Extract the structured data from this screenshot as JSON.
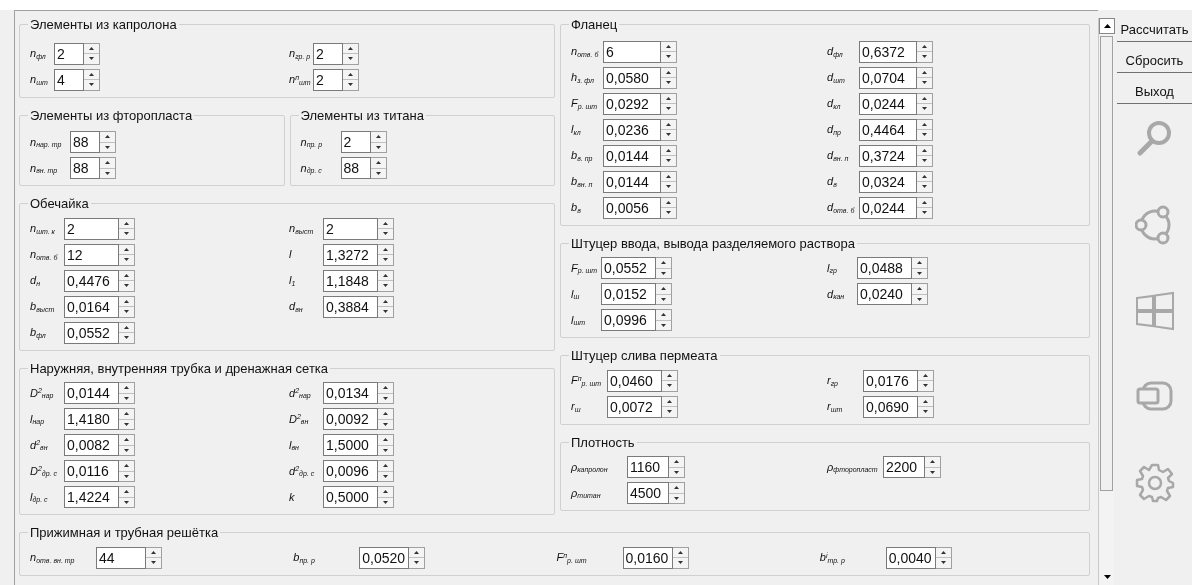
{
  "left": [
    {
      "title": "Элементы из капролона",
      "fields": [
        {
          "label": "n$_{фл}$",
          "value": "2"
        },
        {
          "label": "n$_{гр. р}$",
          "value": "2"
        },
        {
          "label": "n$_{шт}$",
          "value": "4"
        },
        {
          "label": "n$^{п}$$_{шт}$",
          "value": "2"
        }
      ]
    },
    {
      "side_by_side": [
        {
          "title": "Элементы из фторопласта",
          "fields": [
            {
              "label": "n$_{нар. тр}$",
              "value": "88"
            },
            {
              "label": "n$_{вн. тр}$",
              "value": "88"
            }
          ]
        },
        {
          "title": "Элементы из титана",
          "fields": [
            {
              "label": "n$_{пр. р}$",
              "value": "2"
            },
            {
              "label": "n$_{др. с}$",
              "value": "88"
            }
          ]
        }
      ]
    },
    {
      "title": "Обечайка",
      "fields": [
        {
          "label": "n$_{шт. к}$",
          "value": "2"
        },
        {
          "label": "n$_{выст}$",
          "value": "2"
        },
        {
          "label": "n$_{отв. б}$",
          "value": "12"
        },
        {
          "label": "l",
          "value": "1,3272"
        },
        {
          "label": "d$_{н}$",
          "value": "0,4476"
        },
        {
          "label": "l$_{1}$",
          "value": "1,1848"
        },
        {
          "label": "b$_{выст}$",
          "value": "0,0164"
        },
        {
          "label": "d$_{вн}$",
          "value": "0,3884"
        },
        {
          "label": "b$_{фл}$",
          "value": "0,0552"
        }
      ]
    },
    {
      "title": "Наружняя, внутренняя трубка и дренажная сетка",
      "fields": [
        {
          "label": "D$^{2}$$_{нар}$",
          "value": "0,0144"
        },
        {
          "label": "d$^{2}$$_{нар}$",
          "value": "0,0134"
        },
        {
          "label": "l$_{нар}$",
          "value": "1,4180"
        },
        {
          "label": "D$^{2}$$_{вн}$",
          "value": "0,0092"
        },
        {
          "label": "d$^{2}$$_{вн}$",
          "value": "0,0082"
        },
        {
          "label": "l$_{вн}$",
          "value": "1,5000"
        },
        {
          "label": "D$^{2}$$_{др. с}$",
          "value": "0,0116"
        },
        {
          "label": "d$^{2}$$_{др. с}$",
          "value": "0,0096"
        },
        {
          "label": "l$_{др. с}$",
          "value": "1,4224"
        },
        {
          "label": "k",
          "value": "0,5000"
        }
      ]
    }
  ],
  "right": [
    {
      "title": "Фланец",
      "fields": [
        {
          "label": "n$_{отв. б}$",
          "value": "6"
        },
        {
          "label": "d$_{фл}$",
          "value": "0,6372"
        },
        {
          "label": "h$_{з. фл}$",
          "value": "0,0580"
        },
        {
          "label": "d$_{шт}$",
          "value": "0,0704"
        },
        {
          "label": "F$_{р. шт}$",
          "value": "0,0292"
        },
        {
          "label": "d$_{кл}$",
          "value": "0,0244"
        },
        {
          "label": "l$_{кл}$",
          "value": "0,0236"
        },
        {
          "label": "d$_{пр}$",
          "value": "0,4464"
        },
        {
          "label": "b$_{в. пр}$",
          "value": "0,0144"
        },
        {
          "label": "d$_{вн. п}$",
          "value": "0,3724"
        },
        {
          "label": "b$_{вн. п}$",
          "value": "0,0144"
        },
        {
          "label": "d$_{в}$",
          "value": "0,0324"
        },
        {
          "label": "b$_{в}$",
          "value": "0,0056"
        },
        {
          "label": "d$_{отв. б}$",
          "value": "0,0244"
        }
      ]
    },
    {
      "title": "Штуцер ввода, вывода разделяемого раствора",
      "fields": [
        {
          "label": "F$_{р. шт}$",
          "value": "0,0552"
        },
        {
          "label": "l$_{гр}$",
          "value": "0,0488"
        },
        {
          "label": "l$_{ш}$",
          "value": "0,0152"
        },
        {
          "label": "d$_{кан}$",
          "value": "0,0240"
        },
        {
          "label": "l$_{шт}$",
          "value": "0,0996"
        }
      ]
    },
    {
      "title": "Штуцер слива пермеата",
      "fields": [
        {
          "label": "F$^{п}$$_{р. шт}$",
          "value": "0,0460"
        },
        {
          "label": "r$_{гр}$",
          "value": "0,0176"
        },
        {
          "label": "r$_{ш}$",
          "value": "0,0072"
        },
        {
          "label": "r$_{шт}$",
          "value": "0,0690"
        }
      ]
    },
    {
      "title": "Плотность",
      "fields": [
        {
          "label": "ρ$_{капролон}$",
          "value": "1160"
        },
        {
          "label": "ρ$_{фторопласт}$",
          "value": "2200"
        },
        {
          "label": "ρ$_{титан}$",
          "value": "4500"
        }
      ]
    }
  ],
  "bottom": {
    "title": "Прижимная и трубная решётка",
    "fields": [
      {
        "label": "n$_{отв. вн. тр}$",
        "value": "44"
      },
      {
        "label": "b$_{пр. р}$",
        "value": "0,0520"
      },
      {
        "label": "F$^{п}$$_{р. шт}$",
        "value": "0,0160"
      },
      {
        "label": "b$^{і}$$_{тр. р}$",
        "value": "0,0040"
      }
    ]
  },
  "buttons": [
    "Рассчитать",
    "Сбросить",
    "Выход"
  ]
}
